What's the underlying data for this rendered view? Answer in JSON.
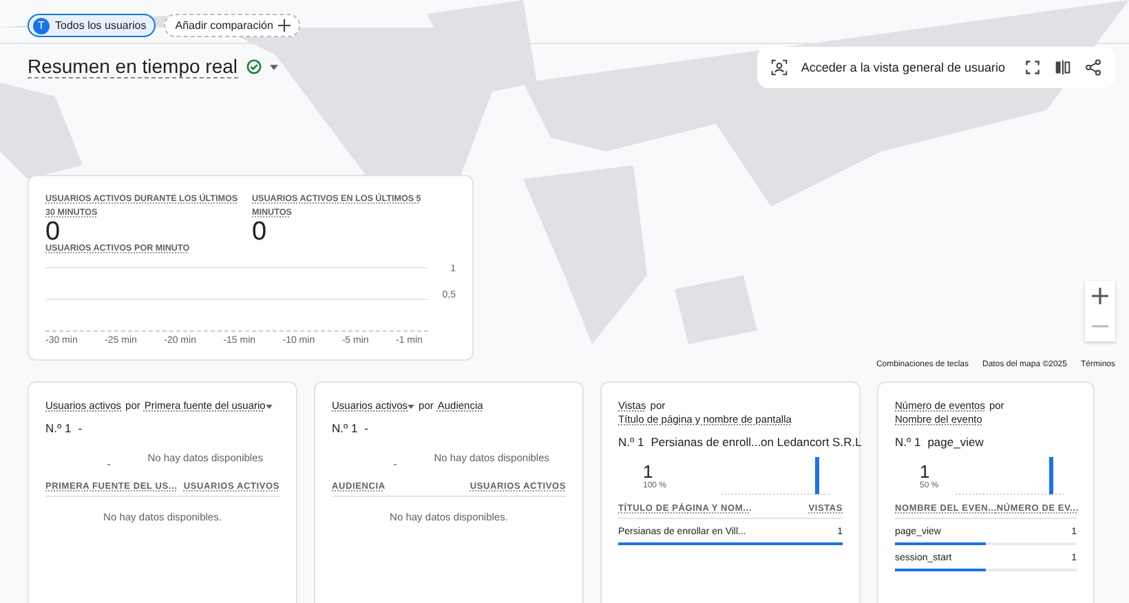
{
  "filters": [
    {
      "kind": "segment",
      "avatar": "T",
      "label": "Todos los usuarios"
    },
    {
      "kind": "add",
      "label": "Añadir comparación"
    }
  ],
  "title": "Resumen en tiempo real",
  "map_toolbar": {
    "link": "Acceder a la vista general de usuario"
  },
  "map_footer": [
    "Combinaciones de teclas",
    "Datos del mapa ©2025",
    "Términos"
  ],
  "summary": {
    "metrics": [
      {
        "label": "USUARIOS ACTIVOS DURANTE LOS ÚLTIMOS 30 MINUTOS",
        "value": "0"
      },
      {
        "label": "USUARIOS ACTIVOS EN LOS ÚLTIMOS 5 MINUTOS",
        "value": "0"
      }
    ],
    "chart_label": "USUARIOS ACTIVOS POR MINUTO",
    "y_ticks": [
      "1",
      "0,5"
    ],
    "x_labels": [
      "-30 min",
      "-25 min",
      "-20 min",
      "-15 min",
      "-10 min",
      "-5 min",
      "-1 min"
    ]
  },
  "cards": [
    {
      "title_parts": [
        {
          "text": "Usuarios activos",
          "kind": "link"
        },
        {
          "text": "por",
          "kind": "text"
        },
        {
          "text": "Primera fuente del usuario",
          "kind": "menu"
        }
      ],
      "rank": "N.º 1",
      "rank_value": "-",
      "kind": "empty",
      "chart_message": "No hay datos disponibles",
      "columns": [
        "PRIMERA FUENTE DEL US...",
        "USUARIOS ACTIVOS"
      ],
      "table_message": "No hay datos disponibles."
    },
    {
      "title_parts": [
        {
          "text": "Usuarios activos",
          "kind": "menu"
        },
        {
          "text": "por",
          "kind": "text"
        },
        {
          "text": "Audiencia",
          "kind": "link"
        }
      ],
      "rank": "N.º 1",
      "rank_value": "-",
      "kind": "empty",
      "chart_message": "No hay datos disponibles",
      "columns": [
        "AUDIENCIA",
        "USUARIOS ACTIVOS"
      ],
      "table_message": "No hay datos disponibles."
    },
    {
      "title_parts": [
        {
          "text": "Vistas",
          "kind": "link"
        },
        {
          "text": "por",
          "kind": "text"
        },
        {
          "text": "Título de página y nombre de pantalla",
          "kind": "link"
        }
      ],
      "rank": "N.º 1",
      "rank_value": "Persianas de enroll...on Ledancort S.R.L",
      "kind": "data",
      "top_value": "1",
      "top_share": "100 %",
      "columns": [
        "TÍTULO DE PÁGINA Y NOM...",
        "VISTAS"
      ],
      "rows": [
        {
          "cells": [
            "Persianas de enrollar en Vill...",
            "1"
          ],
          "level": 1
        }
      ]
    },
    {
      "title_parts": [
        {
          "text": "Número de eventos",
          "kind": "link"
        },
        {
          "text": "por",
          "kind": "text"
        },
        {
          "text": "Nombre del evento",
          "kind": "link"
        }
      ],
      "rank": "N.º 1",
      "rank_value": "page_view",
      "kind": "data",
      "top_value": "1",
      "top_share": "50 %",
      "columns": [
        "NOMBRE DEL EVEN...",
        "NÚMERO DE EV..."
      ],
      "rows": [
        {
          "cells": [
            "page_view",
            "1"
          ],
          "level": 0.5
        },
        {
          "cells": [
            "session_start",
            "1"
          ],
          "level": 0.5
        }
      ]
    }
  ]
}
